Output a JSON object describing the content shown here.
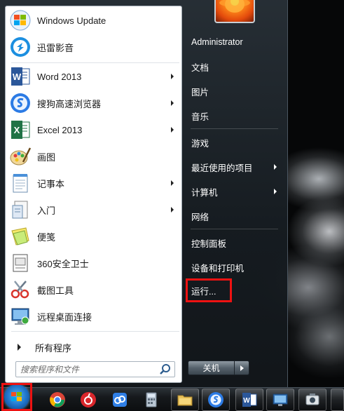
{
  "start_menu": {
    "programs": [
      {
        "label": "Windows Update",
        "icon": "windows-update-icon",
        "arrow": false
      },
      {
        "label": "迅雷影音",
        "icon": "xunlei-player-icon",
        "arrow": false
      },
      {
        "label": "Word 2013",
        "icon": "word-icon",
        "arrow": true
      },
      {
        "label": "搜狗高速浏览器",
        "icon": "sogou-browser-icon",
        "arrow": true
      },
      {
        "label": "Excel 2013",
        "icon": "excel-icon",
        "arrow": true
      },
      {
        "label": "画图",
        "icon": "paint-icon",
        "arrow": false
      },
      {
        "label": "记事本",
        "icon": "notepad-icon",
        "arrow": true
      },
      {
        "label": "入门",
        "icon": "getting-started-icon",
        "arrow": true
      },
      {
        "label": "便笺",
        "icon": "sticky-notes-icon",
        "arrow": false
      },
      {
        "label": "360安全卫士",
        "icon": "360-safeguard-icon",
        "arrow": false
      },
      {
        "label": "截图工具",
        "icon": "snipping-tool-icon",
        "arrow": false
      },
      {
        "label": "远程桌面连接",
        "icon": "remote-desktop-icon",
        "arrow": false
      }
    ],
    "all_programs_label": "所有程序",
    "search": {
      "placeholder": "搜索程序和文件",
      "value": ""
    },
    "right_items": [
      {
        "label": "Administrator",
        "arrow": false
      },
      {
        "label": "文档",
        "arrow": false
      },
      {
        "label": "图片",
        "arrow": false
      },
      {
        "label": "音乐",
        "arrow": false
      },
      {
        "label": "游戏",
        "arrow": false
      },
      {
        "label": "最近使用的项目",
        "arrow": true
      },
      {
        "label": "计算机",
        "arrow": true
      },
      {
        "label": "网络",
        "arrow": false
      },
      {
        "label": "控制面板",
        "arrow": false
      },
      {
        "label": "设备和打印机",
        "arrow": false
      },
      {
        "label": "运行...",
        "arrow": false
      }
    ],
    "shutdown_label": "关机",
    "highlight_color": "#ee1212"
  },
  "taskbar": {
    "items": [
      "start-orb-icon",
      "chrome-icon",
      "netease-music-icon",
      "baidu-netdisk-icon",
      "calculator-icon",
      "file-explorer-icon",
      "sogou-browser-icon",
      "word-icon",
      "remote-desktop-icon",
      "camera-icon"
    ]
  }
}
